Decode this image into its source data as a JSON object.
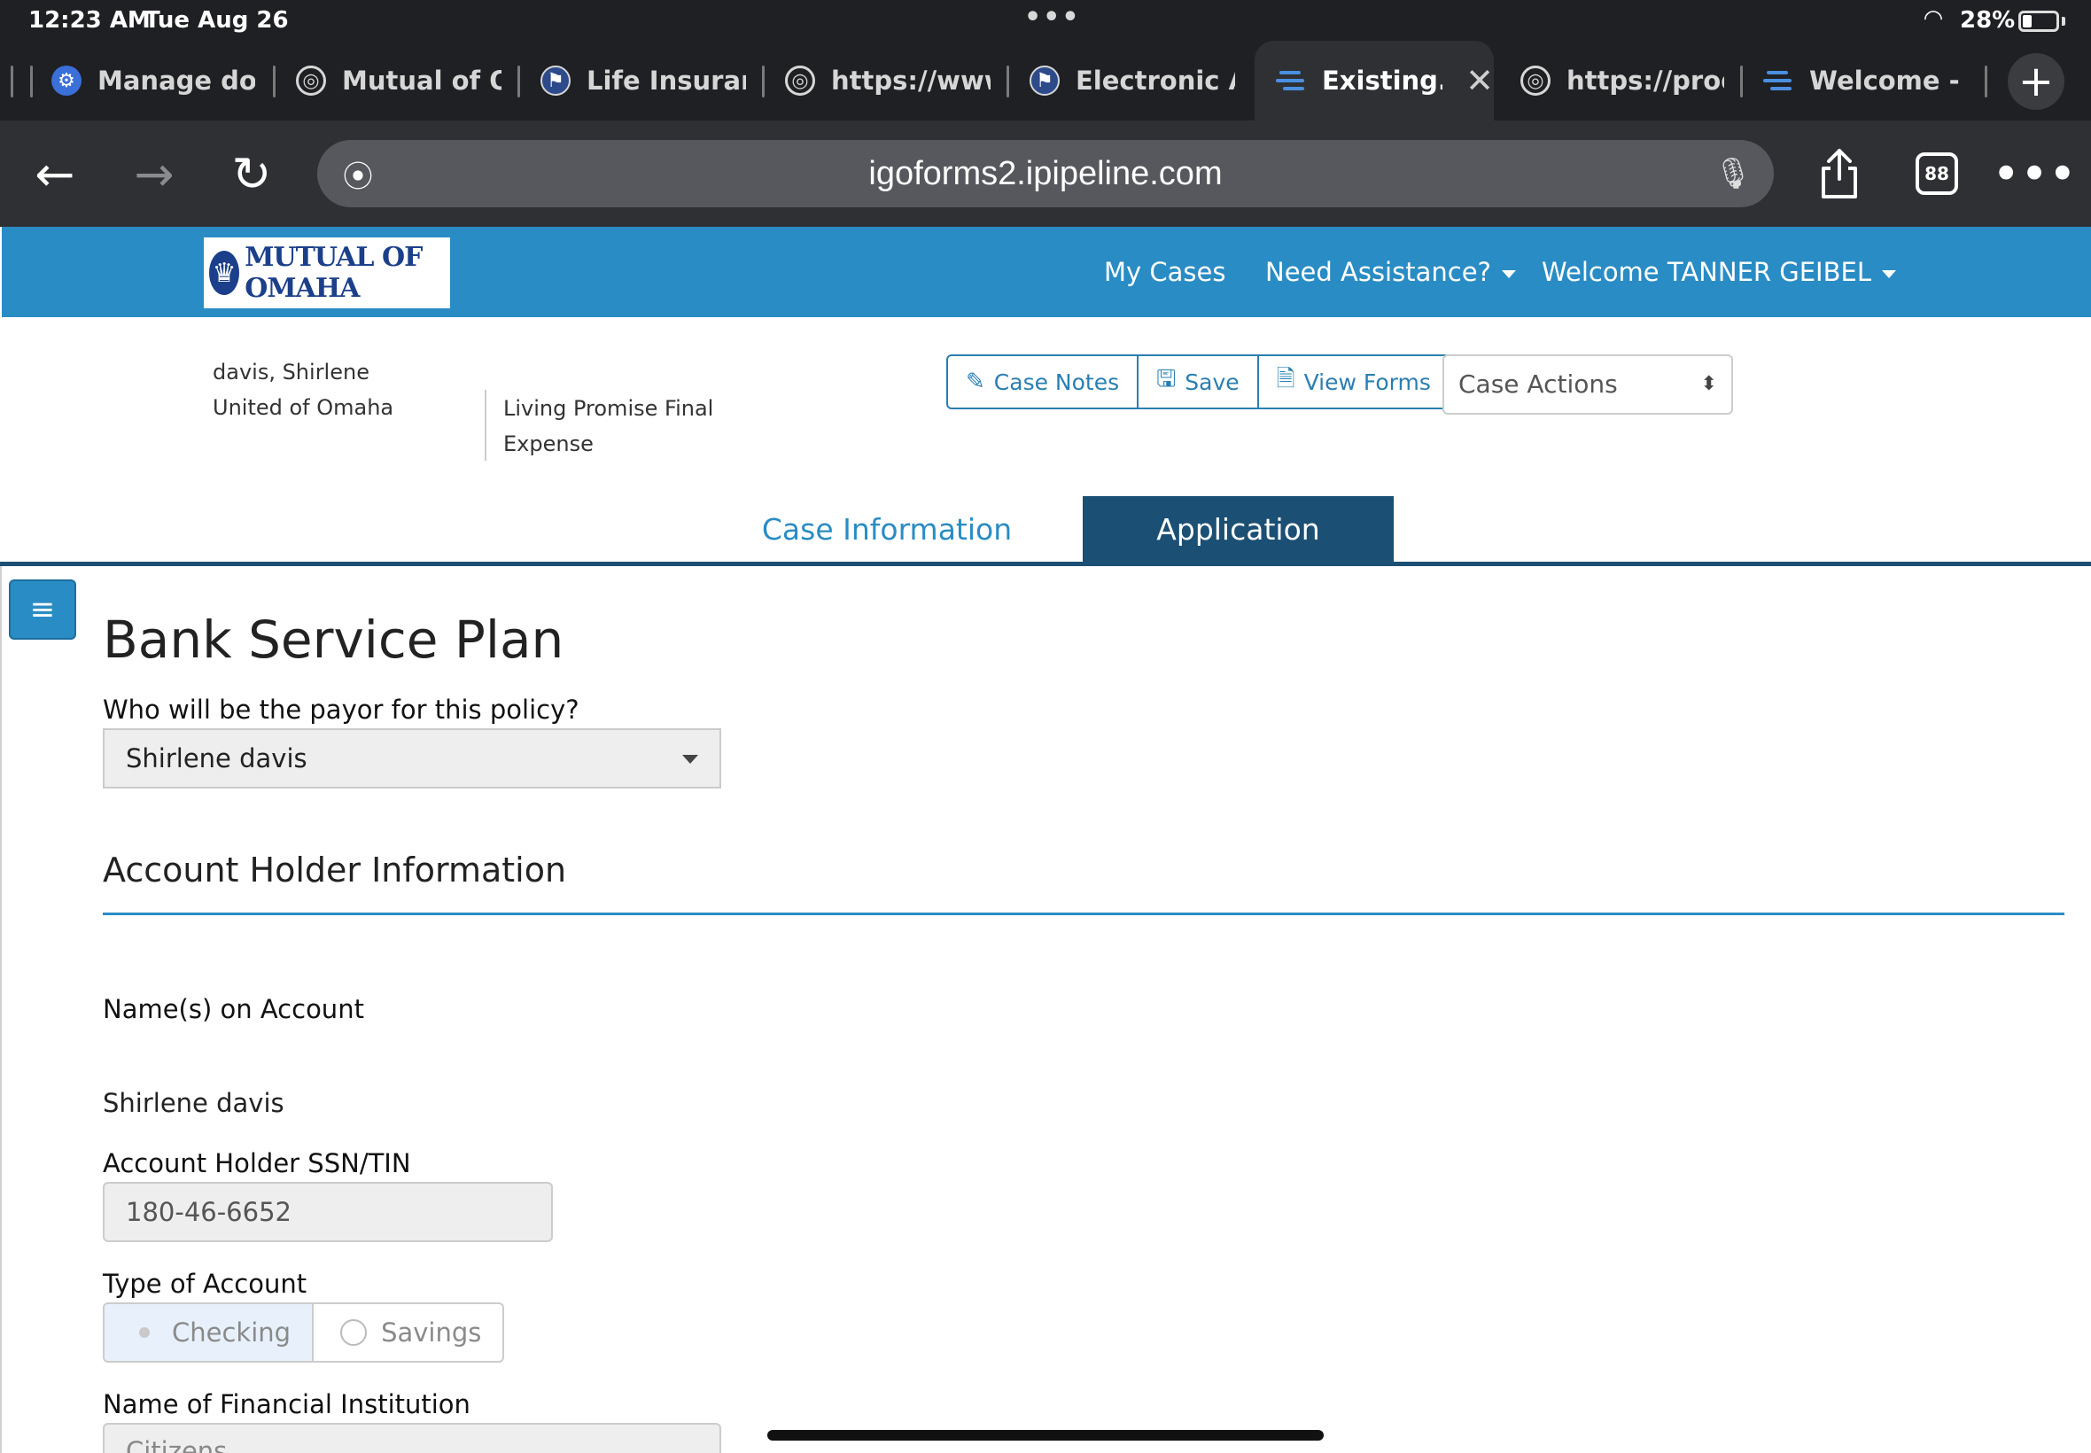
{
  "status_bar": {
    "time": "12:23 AM",
    "date": "Tue Aug 26",
    "battery": "28%",
    "battery_level": 0.28
  },
  "browser": {
    "tabs": [
      {
        "label": "Manage dom",
        "icon": "gear-blue-icon"
      },
      {
        "label": "Mutual of Or",
        "icon": "globe-icon"
      },
      {
        "label": "Life Insuranc",
        "icon": "mutual-logo-icon"
      },
      {
        "label": "https://www",
        "icon": "globe-icon"
      },
      {
        "label": "Electronic A",
        "icon": "mutual-logo-icon"
      },
      {
        "label": "Existing.",
        "icon": "lines-icon",
        "active": true
      },
      {
        "label": "https://prod",
        "icon": "globe-icon"
      },
      {
        "label": "Welcome - if",
        "icon": "lines-icon"
      }
    ],
    "url": "igoforms2.ipipeline.com",
    "tab_count": "88"
  },
  "header": {
    "logo_text": "MUTUAL OF OMAHA",
    "nav": {
      "my_cases": "My Cases",
      "need_assistance": "Need Assistance?",
      "welcome_prefix": "Welcome",
      "user_name": "TANNER GEIBEL"
    }
  },
  "case": {
    "client_name": "davis, Shirlene",
    "company": "United of Omaha",
    "product": "Living Promise Final Expense",
    "buttons": {
      "case_notes": "Case Notes",
      "save": "Save",
      "view_forms": "View Forms"
    },
    "case_actions": "Case Actions"
  },
  "main_tabs": {
    "case_information": "Case Information",
    "application": "Application"
  },
  "form": {
    "title": "Bank Service Plan",
    "payor_label": "Who will be the payor for this policy?",
    "payor_value": "Shirlene davis",
    "account_section": "Account Holder Information",
    "names_label": "Name(s) on Account",
    "names_value": "Shirlene davis",
    "ssn_label": "Account Holder SSN/TIN",
    "ssn_value": "180-46-6652",
    "account_type_label": "Type of Account",
    "account_type_options": [
      "Checking",
      "Savings"
    ],
    "account_type_selected": "Checking",
    "institution_label": "Name of Financial Institution",
    "institution_value": "Citizens"
  },
  "colors": {
    "header_blue": "#2a8cc4",
    "tab_active_navy": "#1b4f74",
    "browser_dark": "#1f2023"
  }
}
